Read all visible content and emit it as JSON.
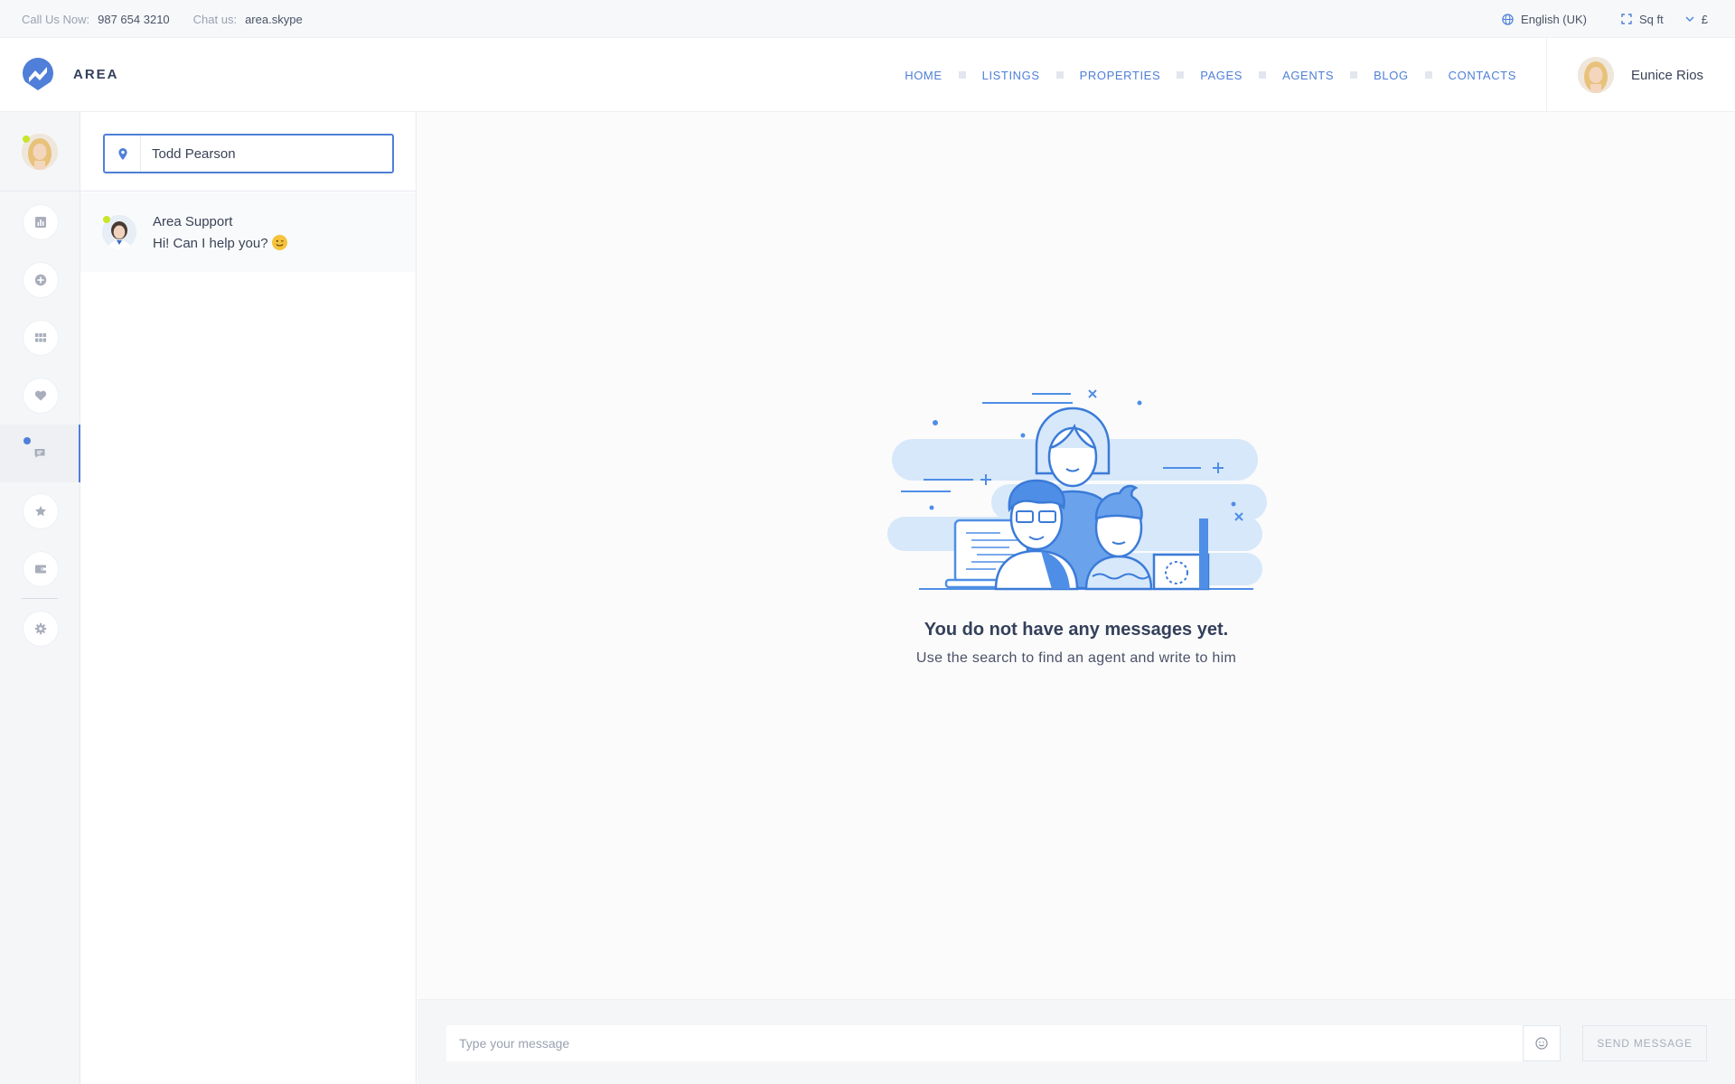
{
  "topbar": {
    "call_label": "Call Us Now:",
    "call_value": "987 654 3210",
    "chat_label": "Chat us:",
    "chat_value": "area.skype",
    "language": "English (UK)",
    "unit": "Sq ft",
    "currency": "£"
  },
  "header": {
    "logo_text": "AREA",
    "nav": [
      "HOME",
      "LISTINGS",
      "PROPERTIES",
      "PAGES",
      "AGENTS",
      "BLOG",
      "CONTACTS"
    ],
    "user_name": "Eunice Rios"
  },
  "sidebar": {
    "icons": [
      "chart-icon",
      "plus-circle-icon",
      "grid-icon",
      "heart-icon",
      "chat-icon",
      "star-icon",
      "wallet-icon",
      "settings-icon"
    ],
    "active": "chat-icon"
  },
  "conversations": {
    "search_value": "Todd Pearson",
    "items": [
      {
        "name": "Area Support",
        "message": "Hi! Can I help you?"
      }
    ]
  },
  "main": {
    "empty_title": "You do not have any messages yet.",
    "empty_subtitle": "Use the search to find an agent and write to him"
  },
  "composer": {
    "placeholder": "Type your message",
    "send_label": "SEND MESSAGE"
  },
  "colors": {
    "accent": "#4f7fd8",
    "online": "#c8e52a",
    "illustration_light": "#d6e8fa",
    "illustration_mid": "#6aa3ec"
  }
}
